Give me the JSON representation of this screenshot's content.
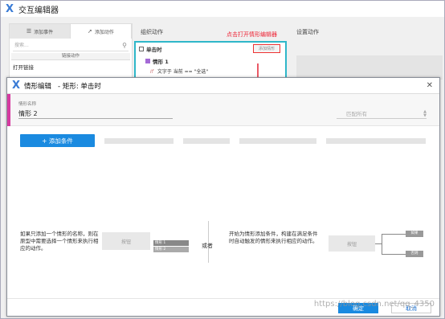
{
  "back_window": {
    "title": "交互编辑器",
    "tabs": [
      {
        "label": "添加事件",
        "icon": "checklist-icon"
      },
      {
        "label": "添加动作",
        "icon": "cursor-icon"
      }
    ],
    "search_placeholder": "搜索...",
    "category": "链接动作",
    "action_item": "打开链接",
    "org_title": "组织动作",
    "settings_title": "设置动作",
    "event": "单击时",
    "add_case": "添加情形",
    "case": "情形 1",
    "condition_if": "If",
    "condition": "文字于 当前 == \"全选\"",
    "note": "点击打开情形编辑器"
  },
  "dialog": {
    "title": "情形编辑",
    "subtitle": "矩形: 单击时",
    "name_label": "情形名称",
    "name_value": "情形 2",
    "match": "匹配所有",
    "add_condition": "+ 添加条件",
    "help_left": "如果只添加一个情形的名称，则在原型中需要选择一个情形来执行相应的动作。",
    "demo_button": "按钮",
    "demo_cases": [
      "情形 1",
      "情形 2"
    ],
    "or": "或者",
    "help_right": "开始为情形添加条件，构建在满足条件时自动触发的情形来执行相应的动作。",
    "demo_branches": [
      "如果",
      "否则"
    ],
    "ok": "确定",
    "cancel": "取消"
  },
  "watermark": "https://blog.csdn.net/qq_4350",
  "colors": {
    "accent": "#1a8ae0",
    "highlight": "#2fb7c9",
    "note_red": "#e22233",
    "case_pink": "#d63aa0",
    "case_purple": "#a46ad6"
  }
}
